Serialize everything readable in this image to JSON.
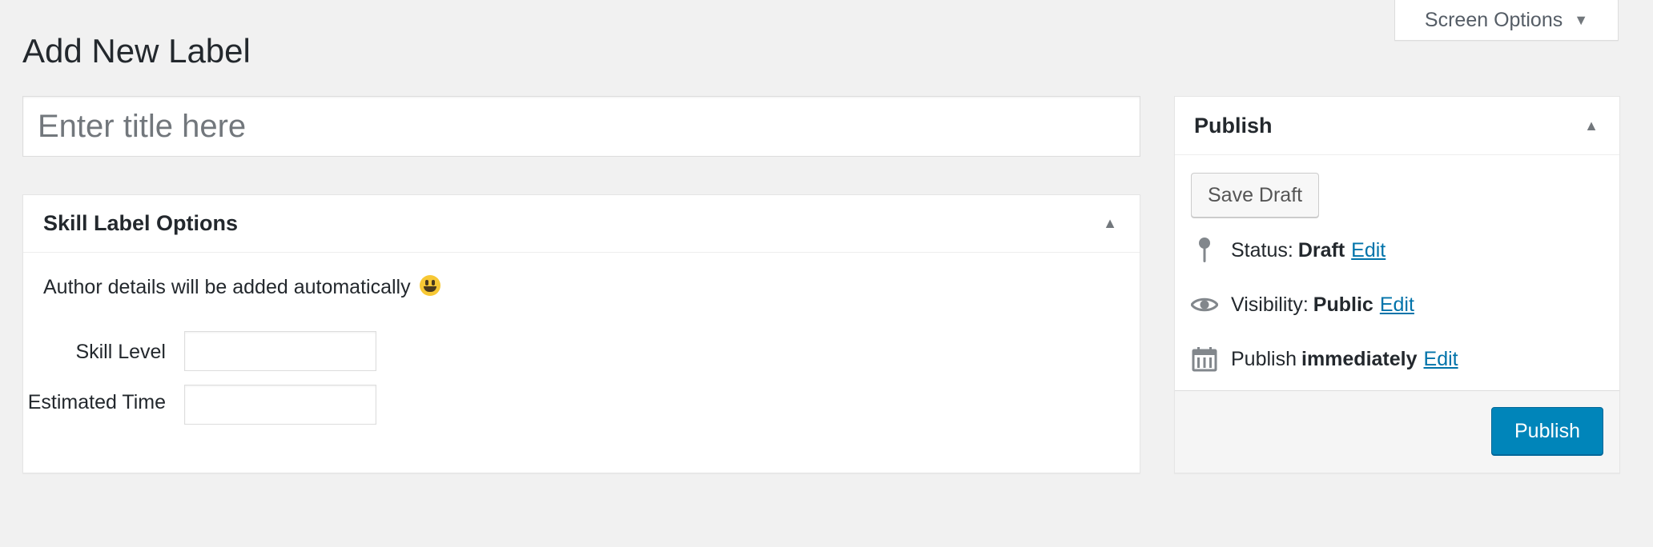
{
  "header": {
    "title": "Add New Label",
    "screen_options_label": "Screen Options"
  },
  "title_field": {
    "placeholder": "Enter title here",
    "value": ""
  },
  "skill_box": {
    "title": "Skill Label Options",
    "note": "Author details will be added automatically",
    "fields": [
      {
        "label": "Skill Level",
        "value": ""
      },
      {
        "label": "Estimated Time",
        "value": ""
      }
    ]
  },
  "publish_box": {
    "title": "Publish",
    "save_draft_label": "Save Draft",
    "status": {
      "label": "Status:",
      "value": "Draft",
      "edit": "Edit"
    },
    "visibility": {
      "label": "Visibility:",
      "value": "Public",
      "edit": "Edit"
    },
    "schedule": {
      "label": "Publish",
      "value": "immediately",
      "edit": "Edit"
    },
    "publish_label": "Publish"
  },
  "icons": {
    "collapse": "triangle-up-icon",
    "screen_options_caret": "triangle-down-icon",
    "status": "pin-icon",
    "visibility": "eye-icon",
    "schedule": "calendar-icon",
    "emoji": "grinning-face-icon"
  },
  "colors": {
    "background": "#f1f1f1",
    "primary_button": "#0085ba",
    "link": "#0073aa"
  }
}
